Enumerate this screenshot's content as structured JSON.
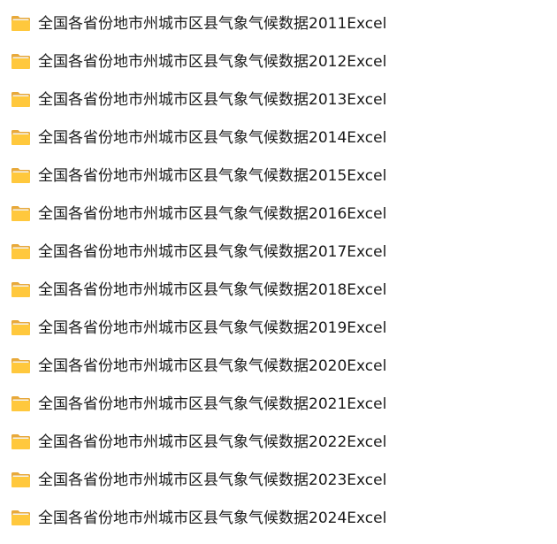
{
  "folders": [
    {
      "name": "全国各省份地市州城市区县气象气候数据2011Excel",
      "icon": "folder-icon"
    },
    {
      "name": "全国各省份地市州城市区县气象气候数据2012Excel",
      "icon": "folder-icon"
    },
    {
      "name": "全国各省份地市州城市区县气象气候数据2013Excel",
      "icon": "folder-icon"
    },
    {
      "name": "全国各省份地市州城市区县气象气候数据2014Excel",
      "icon": "folder-icon"
    },
    {
      "name": "全国各省份地市州城市区县气象气候数据2015Excel",
      "icon": "folder-icon"
    },
    {
      "name": "全国各省份地市州城市区县气象气候数据2016Excel",
      "icon": "folder-icon"
    },
    {
      "name": "全国各省份地市州城市区县气象气候数据2017Excel",
      "icon": "folder-icon"
    },
    {
      "name": "全国各省份地市州城市区县气象气候数据2018Excel",
      "icon": "folder-icon"
    },
    {
      "name": "全国各省份地市州城市区县气象气候数据2019Excel",
      "icon": "folder-icon"
    },
    {
      "name": "全国各省份地市州城市区县气象气候数据2020Excel",
      "icon": "folder-icon"
    },
    {
      "name": "全国各省份地市州城市区县气象气候数据2021Excel",
      "icon": "folder-icon"
    },
    {
      "name": "全国各省份地市州城市区县气象气候数据2022Excel",
      "icon": "folder-icon"
    },
    {
      "name": "全国各省份地市州城市区县气象气候数据2023Excel",
      "icon": "folder-icon"
    },
    {
      "name": "全国各省份地市州城市区县气象气候数据2024Excel",
      "icon": "folder-icon"
    }
  ],
  "colors": {
    "folder_back": "#e8a93a",
    "folder_front": "#ffc83d",
    "folder_paper": "#f4f4f4",
    "text": "#1a1a1a"
  }
}
